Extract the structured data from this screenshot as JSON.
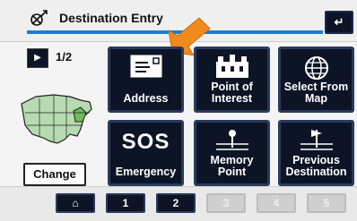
{
  "header": {
    "title": "Destination Entry",
    "back_label": "↵"
  },
  "pager": {
    "text": "1/2"
  },
  "sidebar": {
    "change_label": "Change"
  },
  "tiles": [
    {
      "name": "address",
      "label": "Address"
    },
    {
      "name": "point-of-interest",
      "label": "Point of\nInterest"
    },
    {
      "name": "select-from-map",
      "label": "Select From\nMap"
    },
    {
      "name": "sos-emergency",
      "big": "SOS",
      "label": "Emergency"
    },
    {
      "name": "memory-point",
      "label": "Memory\nPoint"
    },
    {
      "name": "previous-destination",
      "label": "Previous\nDestination"
    }
  ],
  "bottom_tabs": [
    {
      "label": "⌂",
      "state": "active"
    },
    {
      "label": "1",
      "state": "active"
    },
    {
      "label": "2",
      "state": "active"
    },
    {
      "label": "3",
      "state": "disabled"
    },
    {
      "label": "4",
      "state": "disabled"
    },
    {
      "label": "5",
      "state": "disabled"
    }
  ],
  "colors": {
    "accent": "#1e7fd0",
    "tile_bg": "#0d1426",
    "highlight_arrow": "#f08a1c"
  }
}
